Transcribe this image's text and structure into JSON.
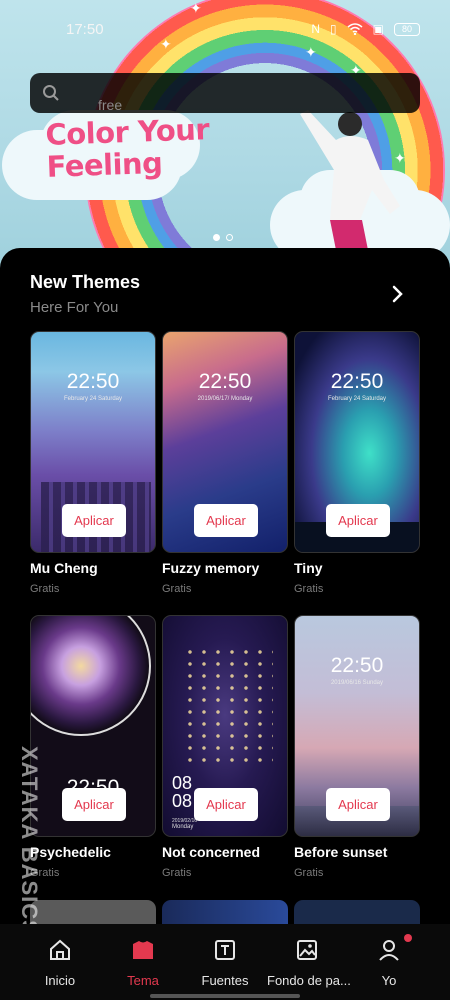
{
  "status_bar": {
    "time": "17:50",
    "battery": "80"
  },
  "banner": {
    "title_line1": "Color Your",
    "title_line2": "Feeling",
    "page_count": 2,
    "active_page": 1
  },
  "search": {
    "placeholder": "free"
  },
  "new_themes": {
    "title": "New Themes",
    "subtitle": "Here For You",
    "themes": [
      {
        "name": "Mu Cheng",
        "price": "Gratis",
        "button": "Aplicar",
        "clock": "22:50",
        "date": "February 24 Saturday"
      },
      {
        "name": "Fuzzy memory",
        "price": "Gratis",
        "button": "Aplicar",
        "clock": "22:50",
        "date": "2019/06/17/ Monday"
      },
      {
        "name": "Tiny",
        "price": "Gratis",
        "button": "Aplicar",
        "clock": "22:50",
        "date": "February 24 Saturday"
      },
      {
        "name": "Psychedelic",
        "price": "Gratis",
        "button": "Aplicar",
        "clock": "22:50",
        "date": ""
      },
      {
        "name": "Not concerned",
        "price": "Gratis",
        "button": "Aplicar",
        "clock_h": "08",
        "clock_m": "08",
        "date": "2019/02/16",
        "day": "Monday"
      },
      {
        "name": "Before sunset",
        "price": "Gratis",
        "button": "Aplicar",
        "clock": "22:50",
        "date": "2019/06/16 Sunday"
      }
    ]
  },
  "bottom_nav": {
    "items": [
      {
        "label": "Inicio",
        "icon": "home-icon"
      },
      {
        "label": "Tema",
        "icon": "theme-shirt-icon"
      },
      {
        "label": "Fuentes",
        "icon": "font-icon"
      },
      {
        "label": "Fondo de pa...",
        "icon": "wallpaper-icon"
      },
      {
        "label": "Yo",
        "icon": "profile-icon"
      }
    ],
    "active_index": 1,
    "accent_color": "#e3394f"
  },
  "watermark": {
    "text": "XATAKA BASICS"
  }
}
